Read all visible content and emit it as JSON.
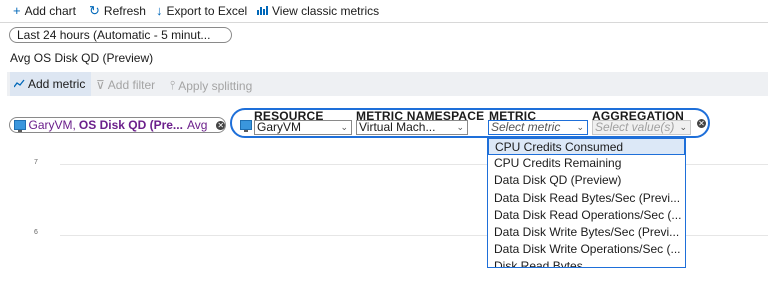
{
  "toolbar": {
    "add_chart": "Add chart",
    "refresh": "Refresh",
    "export": "Export to Excel",
    "classic": "View classic metrics"
  },
  "time_range": "Last 24 hours (Automatic - 5 minut...",
  "chart_title": "Avg OS Disk QD (Preview)",
  "command_bar": {
    "add_metric": "Add metric",
    "add_filter": "Add filter",
    "apply_splitting": "Apply splitting"
  },
  "existing_metric": {
    "resource": "GaryVM,",
    "metric": "OS Disk QD (Pre...",
    "aggregation": "Avg"
  },
  "builder": {
    "resource_label": "RESOURCE",
    "resource_value": "GaryVM",
    "namespace_label": "METRIC NAMESPACE",
    "namespace_value": "Virtual Mach...",
    "metric_label": "METRIC",
    "metric_placeholder": "Select metric",
    "aggregation_label": "AGGREGATION",
    "aggregation_placeholder": "Select value(s)"
  },
  "y_ticks": [
    "7",
    "6"
  ],
  "dropdown_items": [
    "CPU Credits Consumed",
    "CPU Credits Remaining",
    "Data Disk QD (Preview)",
    "Data Disk Read Bytes/Sec (Previ...",
    "Data Disk Read Operations/Sec (...",
    "Data Disk Write Bytes/Sec (Previ...",
    "Data Disk Write Operations/Sec (...",
    "Disk Read Bytes"
  ],
  "colors": {
    "accent": "#1e6fd9",
    "metric_purple": "#6b1f8b"
  }
}
